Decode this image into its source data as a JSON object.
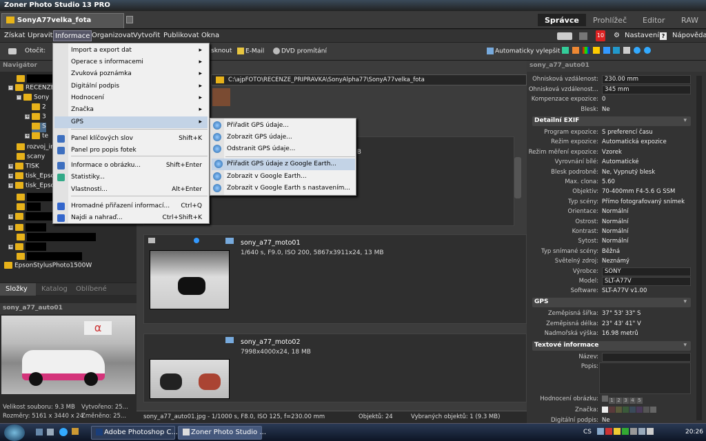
{
  "window": {
    "title": "Zoner Photo Studio 13 PRO"
  },
  "doc_tab": {
    "label": "SonyA77velka_fota"
  },
  "modes": [
    "Správce",
    "Prohlížeč",
    "Editor",
    "RAW"
  ],
  "menubar": [
    "Získat",
    "Upravit",
    "Informace",
    "Organizovat",
    "Vytvořit",
    "Publikovat",
    "Okna"
  ],
  "menubar_right": {
    "badge": "10",
    "settings": "Nastavení",
    "help": "Nápověda"
  },
  "toolbar": {
    "rotate": "Otočit:",
    "hidden_item": "sknout",
    "email": "E-Mail",
    "dvd": "DVD promítání",
    "auto_improve": "Automaticky vylepšit"
  },
  "info_menu": {
    "items": [
      {
        "label": "Import a export dat",
        "submenu": true
      },
      {
        "label": "Operace s informacemi",
        "submenu": true
      },
      {
        "label": "Zvuková poznámka",
        "submenu": true
      },
      {
        "label": "Digitální podpis",
        "submenu": true
      },
      {
        "label": "Hodnocení",
        "submenu": true
      },
      {
        "label": "Značka",
        "submenu": true
      },
      {
        "label": "GPS",
        "submenu": true,
        "highlight": true
      },
      {
        "label": "Panel klíčových slov",
        "shortcut": "Shift+K"
      },
      {
        "label": "Panel pro popis fotek",
        "shortcut": ""
      },
      {
        "label": "Informace o obrázku...",
        "shortcut": "Shift+Enter"
      },
      {
        "label": "Statistiky...",
        "shortcut": ""
      },
      {
        "label": "Vlastnosti...",
        "shortcut": "Alt+Enter"
      },
      {
        "label": "Hromadné přiřazení informací...",
        "shortcut": "Ctrl+Q"
      },
      {
        "label": "Najdi a nahraď...",
        "shortcut": "Ctrl+Shift+K"
      }
    ]
  },
  "gps_menu": {
    "items": [
      {
        "label": "Přiřadit GPS údaje..."
      },
      {
        "label": "Zobrazit GPS údaje..."
      },
      {
        "label": "Odstranit GPS údaje..."
      },
      {
        "label": "Přiřadit GPS údaje z Google Earth...",
        "highlight": true
      },
      {
        "label": "Zobrazit v Google Earth..."
      },
      {
        "label": "Zobrazit v Google Earth s nastavením..."
      }
    ]
  },
  "navigator": {
    "title": "Navigátor",
    "tree": [
      "RECENZE",
      "Sony",
      "2",
      "3",
      "S",
      "te",
      "rozvoj_ir",
      "scany",
      "TISK",
      "tisk_Epsc",
      "tisk_Epsc",
      "EpsonStylusPhoto1500W"
    ],
    "tabs": [
      "Složky",
      "Katalog",
      "Oblíbené"
    ]
  },
  "preview": {
    "title": "sony_a77_auto01",
    "size": "Velikost souboru: 9.3 MB",
    "created": "Vytvořeno: 25...",
    "dims": "Rozměry: 5161 x 3440 x 24",
    "modified": "Změněno: 25..."
  },
  "center": {
    "path": "C:\\ajpFOTO\\RECENZE_PRIPRAVKA\\SonyAlpha77\\SonyA77velka_fota",
    "partial_mb": "MB",
    "items": [
      {
        "name": "sony_a77_moto01",
        "info": "1/640 s, F9.0, ISO 200, 5867x3911x24, 13 MB"
      },
      {
        "name": "sony_a77_moto02",
        "info": "7998x4000x24, 18 MB"
      }
    ],
    "status": {
      "file": "sony_a77_auto01.jpg - 1/1000 s, F8.0, ISO 125, f=230.00 mm",
      "count": "Objektů: 24",
      "selected": "Vybraných objektů: 1 (9.3 MB)"
    }
  },
  "right": {
    "title": "sony_a77_auto01",
    "top": [
      {
        "k": "Ohnisková vzdálenost:",
        "v": "230.00 mm",
        "boxed": true
      },
      {
        "k": "Ohnisková vzdálenost...",
        "v": "345 mm",
        "boxed": true
      },
      {
        "k": "Kompenzace expozice:",
        "v": "0"
      },
      {
        "k": "Blesk:",
        "v": "Ne"
      }
    ],
    "exif_title": "Detailní EXIF",
    "exif": [
      {
        "k": "Program expozice:",
        "v": "S preferencí času"
      },
      {
        "k": "Režim expozice:",
        "v": "Automatická expozice"
      },
      {
        "k": "Režim měření expozice:",
        "v": "Vzorek"
      },
      {
        "k": "Vyrovnání bílé:",
        "v": "Automatické"
      },
      {
        "k": "Blesk podrobně:",
        "v": "Ne, Vypnutý blesk"
      },
      {
        "k": "Max. clona:",
        "v": "5.60"
      },
      {
        "k": "Objektiv:",
        "v": "70-400mm F4-5.6 G SSM"
      },
      {
        "k": "Typ scény:",
        "v": "Přímo fotografovaný snímek"
      },
      {
        "k": "Orientace:",
        "v": "Normální"
      },
      {
        "k": "Ostrost:",
        "v": "Normální"
      },
      {
        "k": "Kontrast:",
        "v": "Normální"
      },
      {
        "k": "Sytost:",
        "v": "Normální"
      },
      {
        "k": "Typ snímané scény:",
        "v": "Běžná"
      },
      {
        "k": "Světelný zdroj:",
        "v": "Neznámý"
      },
      {
        "k": "Výrobce:",
        "v": "SONY",
        "boxed": true
      },
      {
        "k": "Model:",
        "v": "SLT-A77V",
        "boxed": true
      },
      {
        "k": "Software:",
        "v": "SLT-A77V v1.00"
      }
    ],
    "gps_title": "GPS",
    "gps": [
      {
        "k": "Zeměpisná šířka:",
        "v": "37° 53' 33\" S"
      },
      {
        "k": "Zeměpisná délka:",
        "v": "23° 43' 41\" V"
      },
      {
        "k": "Nadmořská výška:",
        "v": "16.98 metrů"
      }
    ],
    "text_title": "Textové informace",
    "text": [
      {
        "k": "Název:",
        "v": ""
      },
      {
        "k": "Popis:",
        "v": ""
      }
    ],
    "rating_label": "Hodnocení obrázku:",
    "rating_nums": [
      "1",
      "2",
      "3",
      "4",
      "5"
    ],
    "tag_label": "Značka:",
    "sign_label": "Digitální podpis:",
    "sign_val": "Ne"
  },
  "taskbar": {
    "tasks": [
      "Adobe Photoshop C...",
      "Zoner Photo Studio ..."
    ],
    "lang": "CS",
    "time": "20:26"
  }
}
